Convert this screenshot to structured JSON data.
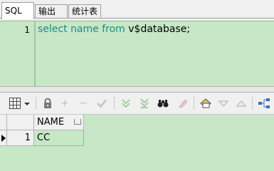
{
  "tabs": [
    {
      "label": "SQL",
      "active": true
    },
    {
      "label": "输出",
      "active": false
    },
    {
      "label": "统计表",
      "active": false
    }
  ],
  "editor": {
    "line_number": "1",
    "code_parts": {
      "kw1": "select",
      "sp1": " ",
      "kw2": "name",
      "sp2": " ",
      "kw3": "from",
      "rest": " v$database;"
    }
  },
  "toolbar": {
    "icons": [
      "grid-options-icon",
      "dropdown-arrow-icon",
      "lock-icon",
      "add-record-icon",
      "delete-record-icon",
      "post-changes-icon",
      "fetch-next-icon",
      "fetch-last-icon",
      "query-by-example-icon",
      "clear-icon",
      "export-icon",
      "sort-down-icon",
      "sort-up-icon",
      "tree-view-icon"
    ]
  },
  "grid": {
    "columns": [
      "NAME"
    ],
    "rows": [
      {
        "row_number": "1",
        "cells": [
          "CC"
        ]
      }
    ]
  },
  "colors": {
    "editor_bg": "#c7e7c7",
    "keyword": "#1e8a8a"
  }
}
